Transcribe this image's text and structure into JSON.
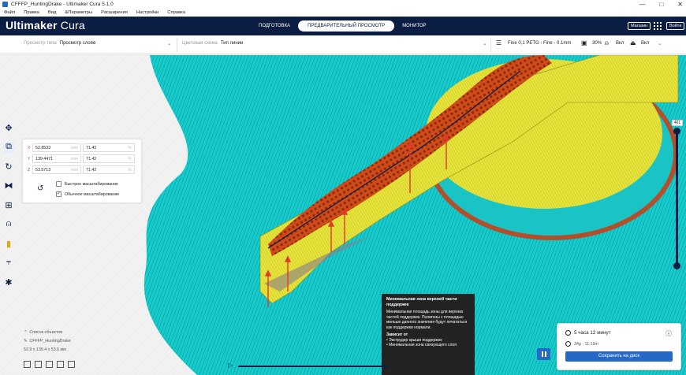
{
  "window": {
    "title": "CFFFP_HuntingDrake - Ultimaker Cura 5.1.0",
    "minimize": "—",
    "maximize": "□",
    "close": "✕"
  },
  "menu": [
    "Файл",
    "Правка",
    "Вид",
    "&Параметры",
    "Расширения",
    "Настройки",
    "Справка"
  ],
  "header": {
    "logo_bold": "Ultimaker",
    "logo_thin": " Cura",
    "tabs": [
      {
        "label": "ПОДГОТОВКА"
      },
      {
        "label": "ПРЕДВАРИТЕЛЬНЫЙ ПРОСМОТР"
      },
      {
        "label": "МОНИТОР"
      }
    ],
    "marketplace": "Магазин",
    "signin": "Войти"
  },
  "stage": {
    "view_type_label": "Просмотр типа",
    "view_type_value": "Просмотр слоёв",
    "color_scheme_label": "Цветовая схема",
    "color_scheme_value": "Тип линии",
    "profile": "Fine 0,1 PETG - Fine - 0.1mm",
    "infill": "30%",
    "support": "Вкл",
    "adhesion": "Вкл"
  },
  "scale": {
    "rows": [
      {
        "axis": "X",
        "mm": "52.8533",
        "pct": "71.42",
        "color": "#d9413f"
      },
      {
        "axis": "Y",
        "mm": "139.4471",
        "pct": "71.42",
        "color": "#2e9e4a"
      },
      {
        "axis": "Z",
        "mm": "53.5713",
        "pct": "71.42",
        "color": "#2668c6"
      }
    ],
    "unit_mm": "mm",
    "unit_pct": "%",
    "snap_label": "Быстрое масштабирование",
    "uniform_label": "Обычное масштабирование",
    "snap_checked": false,
    "uniform_checked": true
  },
  "layer": {
    "number": "461"
  },
  "tooltip": {
    "title": "Минимальная зона верхней части поддержек",
    "body": "Минимальная площадь зоны для верхних частей поддержек. Полигоны с площадью меньше данного значения будут печататься как поддержки нормали.",
    "depends_title": "Зависит от",
    "depends": [
      "• Экструдер крыши поддержек",
      "• Минимальная зона связующего слоя"
    ]
  },
  "objects": {
    "header": "Список объектов",
    "name": "CFFFP_HuntingDrake",
    "dims": "52.9 x 139.4 x 53.6 мм"
  },
  "print": {
    "time": "5 часа 12 минут",
    "material": "34g · 11.19m",
    "save": "Сохранить на диск"
  },
  "colors": {
    "skirt": "#14c8c8",
    "support": "#e8e43a",
    "wall": "#cc4a1a",
    "plate": "#cfcfcf",
    "header": "#0c1d44",
    "accent": "#2668c6"
  }
}
